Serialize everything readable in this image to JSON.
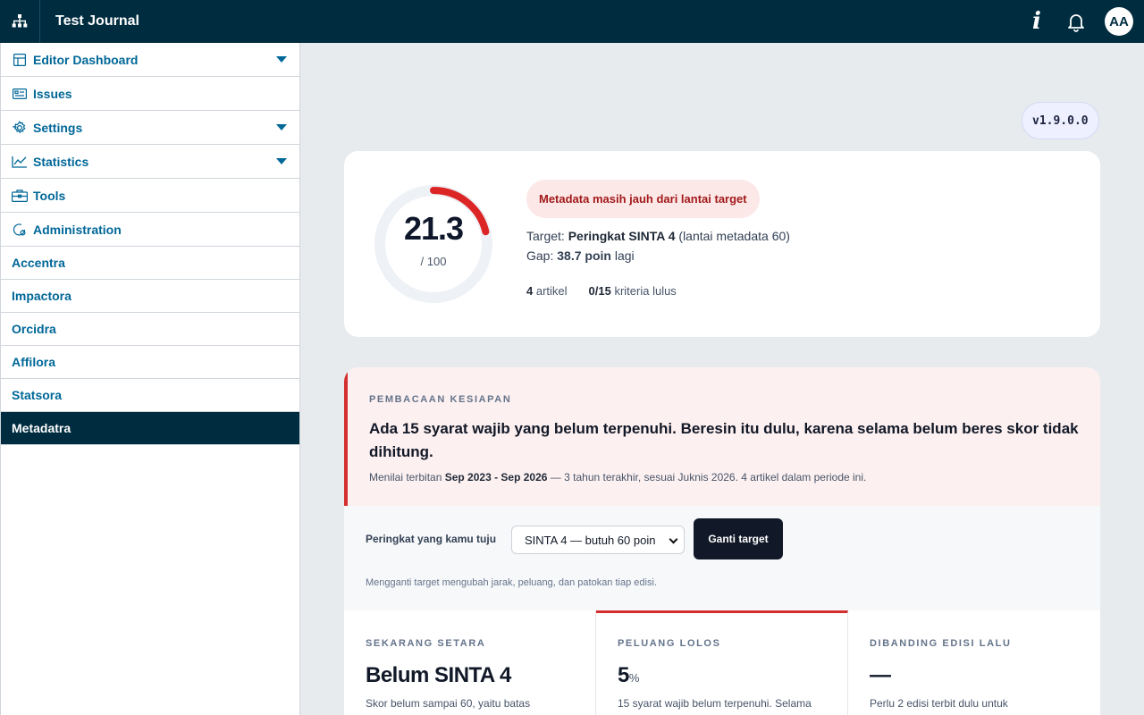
{
  "header": {
    "journal_title": "Test Journal",
    "info_label": "i",
    "avatar_initials": "AA"
  },
  "sidebar": {
    "items": [
      {
        "label": "Editor Dashboard",
        "icon": "dashboard-icon",
        "expandable": true
      },
      {
        "label": "Issues",
        "icon": "issues-icon",
        "expandable": false
      },
      {
        "label": "Settings",
        "icon": "gear-icon",
        "expandable": true
      },
      {
        "label": "Statistics",
        "icon": "chart-line-icon",
        "expandable": true
      },
      {
        "label": "Tools",
        "icon": "toolbox-icon",
        "expandable": false
      },
      {
        "label": "Administration",
        "icon": "admin-icon",
        "expandable": false
      },
      {
        "label": "Accentra"
      },
      {
        "label": "Impactora"
      },
      {
        "label": "Orcidra"
      },
      {
        "label": "Affilora"
      },
      {
        "label": "Statsora"
      },
      {
        "label": "Metadatra",
        "active": true
      }
    ]
  },
  "version": "v1.9.0.0",
  "score": {
    "value": "21.3",
    "max_label": "/ 100",
    "value_numeric": 21.3,
    "max_numeric": 100,
    "status_label": "Metadata masih jauh dari lantai target",
    "target_prefix": "Target: ",
    "target_name": "Peringkat SINTA 4",
    "target_suffix": " (lantai metadata 60)",
    "gap_prefix": "Gap: ",
    "gap_value": "38.7 poin",
    "gap_suffix": " lagi",
    "articles_count": "4",
    "articles_label": " artikel",
    "criteria_count": "0/15",
    "criteria_label": " kriteria lulus"
  },
  "readiness": {
    "eyebrow": "PEMBACAAN KESIAPAN",
    "title": "Ada 15 syarat wajib yang belum terpenuhi. Beresin itu dulu, karena selama belum beres skor tidak dihitung.",
    "sub_prefix": "Menilai terbitan ",
    "sub_period": "Sep 2023 - Sep 2026",
    "sub_suffix": " — 3 tahun terakhir, sesuai Juknis 2026. 4 artikel dalam periode ini.",
    "target_label": "Peringkat yang kamu tuju",
    "target_select": "SINTA 4 — butuh 60 poin",
    "change_button": "Ganti target",
    "help_text": "Mengganti target mengubah jarak, peluang, dan patokan tiap edisi."
  },
  "stats": [
    {
      "eyebrow": "SEKARANG SETARA",
      "value": "Belum SINTA 4",
      "unit": "",
      "desc": "Skor belum sampai 60, yaitu batas"
    },
    {
      "eyebrow": "PELUANG LOLOS",
      "value": "5",
      "unit": "%",
      "desc": "15 syarat wajib belum terpenuhi. Selama"
    },
    {
      "eyebrow": "DIBANDING EDISI LALU",
      "value": "—",
      "unit": "",
      "desc": "Perlu 2 edisi terbit dulu untuk"
    }
  ],
  "colors": {
    "topbar": "#002c40",
    "link": "#006798",
    "gauge_arc": "#dc2626",
    "warn": "#a11a1a"
  }
}
